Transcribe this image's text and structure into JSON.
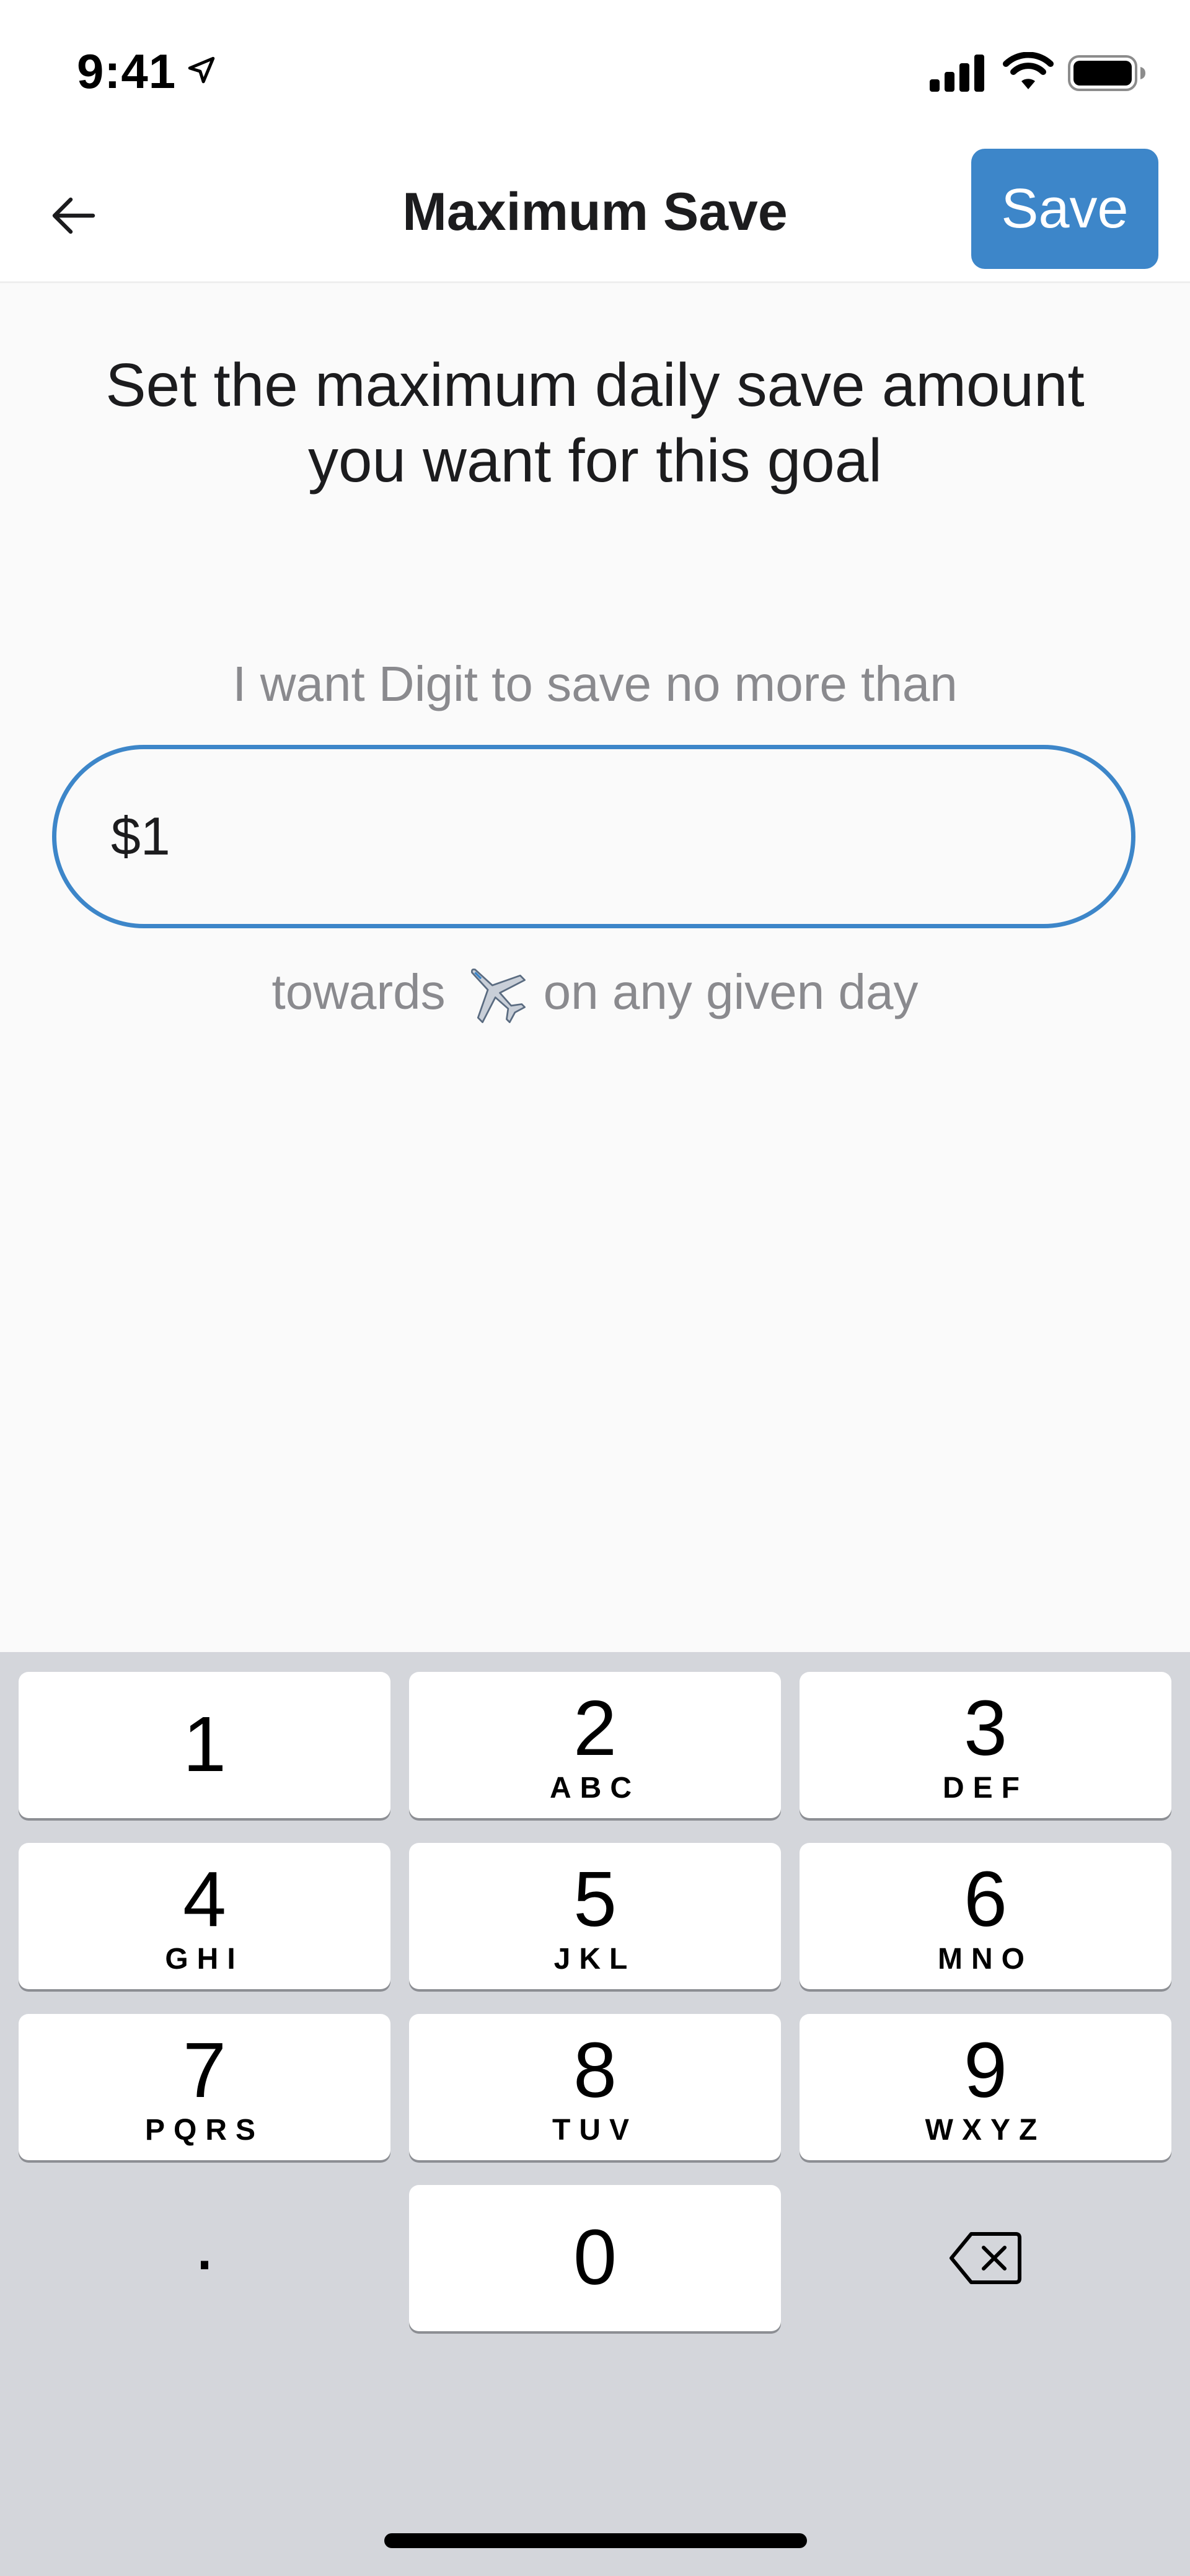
{
  "status_bar": {
    "time": "9:41"
  },
  "nav": {
    "title": "Maximum Save",
    "save_label": "Save"
  },
  "main": {
    "headline_line1": "Set the maximum daily save amount",
    "headline_line2": "you want for this goal",
    "prompt": "I want Digit to save no more than",
    "amount_value": "$1",
    "suffix_before": "towards",
    "suffix_after": "on any given day",
    "goal_icon": "airplane-icon"
  },
  "keypad": {
    "keys": [
      {
        "digit": "1",
        "letters": ""
      },
      {
        "digit": "2",
        "letters": "ABC"
      },
      {
        "digit": "3",
        "letters": "DEF"
      },
      {
        "digit": "4",
        "letters": "GHI"
      },
      {
        "digit": "5",
        "letters": "JKL"
      },
      {
        "digit": "6",
        "letters": "MNO"
      },
      {
        "digit": "7",
        "letters": "PQRS"
      },
      {
        "digit": "8",
        "letters": "TUV"
      },
      {
        "digit": "9",
        "letters": "WXYZ"
      }
    ],
    "zero": "0",
    "decimal": "."
  },
  "colors": {
    "accent": "#3d86c9",
    "keypad_bg": "#d4d6db",
    "secondary_text": "#8a8a8e"
  }
}
